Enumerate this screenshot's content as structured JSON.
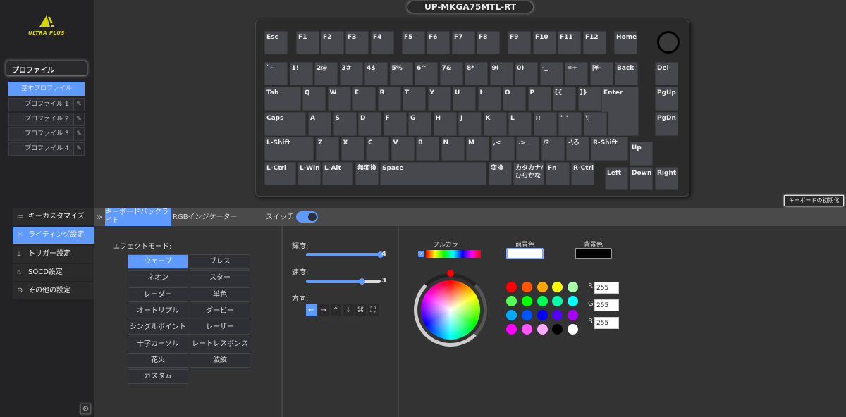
{
  "app": {
    "device_title": "UP-MKGA75MTL-RT",
    "logo_text": "ULTRA PLUS",
    "reset_button": "キーボードの初期化"
  },
  "profiles": {
    "header": "プロファイル",
    "base": "基本プロファイル",
    "items": [
      "プロファイル 1",
      "プロファイル 2",
      "プロファイル 3",
      "プロファイル 4"
    ]
  },
  "nav": [
    {
      "label": "キーカスタマイズ",
      "icon": "keyboard-icon"
    },
    {
      "label": "ライティング設定",
      "icon": "lightbulb-icon",
      "active": true
    },
    {
      "label": "トリガー設定",
      "icon": "trigger-icon"
    },
    {
      "label": "SOCD設定",
      "icon": "hand-icon"
    },
    {
      "label": "その他の設定",
      "icon": "more-icon"
    }
  ],
  "tabs": {
    "expand": "»",
    "backlight": "キーボードバックライト",
    "rgb_indicator": "RGBインジケーター",
    "switch_label": "スイッチ",
    "switch_on": true
  },
  "keyboard": {
    "f_row": [
      "Esc",
      "F1",
      "F2",
      "F3",
      "F4",
      "F5",
      "F6",
      "F7",
      "F8",
      "F9",
      "F10",
      "F11",
      "F12",
      "Home"
    ],
    "num_row": [
      "`~",
      "1!",
      "2@",
      "3#",
      "4$",
      "5%",
      "6^",
      "7&",
      "8*",
      "9(",
      "0)",
      "-_",
      "=+",
      "|¥-",
      "Back",
      "Del"
    ],
    "q_row": [
      "Tab",
      "Q",
      "W",
      "E",
      "R",
      "T",
      "Y",
      "U",
      "I",
      "O",
      "P",
      "[{",
      "]}",
      "Enter",
      "PgUp"
    ],
    "a_row": [
      "Caps",
      "A",
      "S",
      "D",
      "F",
      "G",
      "H",
      "J",
      "K",
      "L",
      ";:",
      "\" '",
      "\\|",
      "PgDn"
    ],
    "z_row": [
      "L-Shift",
      "Z",
      "X",
      "C",
      "V",
      "B",
      "N",
      "M",
      ",<",
      ".>",
      "/?",
      "-\\ろ",
      "R-Shift",
      "Up"
    ],
    "bottom_row": [
      "L-Ctrl",
      "L-Win",
      "L-Alt",
      "無変換",
      "Space",
      "変換",
      "カタカナ/\nひらかな",
      "Fn",
      "R-Ctrl",
      "Left",
      "Down",
      "Right"
    ]
  },
  "effects": {
    "label": "エフェクトモード:",
    "modes": [
      "ウェーブ",
      "ブレス",
      "ネオン",
      "スター",
      "レーダー",
      "単色",
      "オートリプル",
      "ダービー",
      "シングルポイント",
      "レーザー",
      "十字カーソル",
      "レートレスポンス",
      "花火",
      "波紋",
      "カスタム"
    ],
    "selected": "ウェーブ"
  },
  "controls": {
    "brightness_label": "輝度:",
    "brightness": 4,
    "speed_label": "速度:",
    "speed": 3,
    "max": 4,
    "direction_label": "方向:",
    "directions": [
      "←",
      "→",
      "↑",
      "↓",
      "⌘",
      "⛶"
    ],
    "direction_selected": 0
  },
  "color": {
    "full_color_label": "フルカラー",
    "full_color_checked": true,
    "fg_label": "前景色",
    "fg": "#ffffff",
    "bg_label": "背景色",
    "bg": "#000000",
    "swatches": [
      "#ff0000",
      "#ff5500",
      "#ffa500",
      "#ffff00",
      "#aaffaa",
      "#55ff55",
      "#00ff00",
      "#00ff55",
      "#00ffaa",
      "#00ffff",
      "#00aaff",
      "#0055ff",
      "#0000ff",
      "#5500ff",
      "#aa00ff",
      "#ff00ff",
      "#ff55ff",
      "#ffaaff",
      "#000000",
      "#ffffff"
    ],
    "r_label": "R",
    "g_label": "G",
    "b_label": "B",
    "r": "255",
    "g": "255",
    "b": "255"
  },
  "accent": "#5f9bff"
}
